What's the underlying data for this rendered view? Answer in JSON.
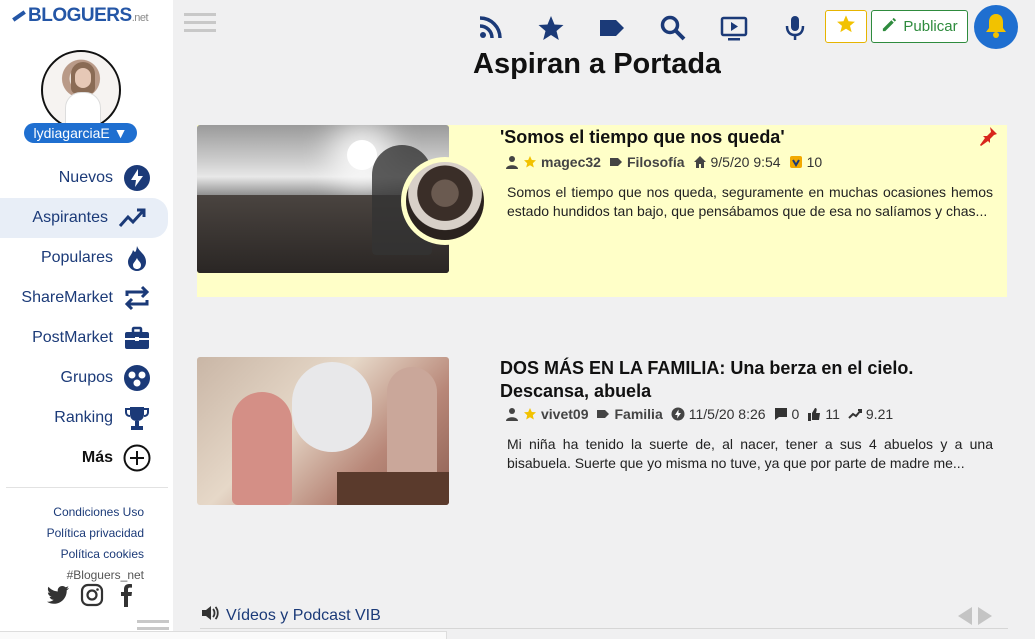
{
  "brand": {
    "name": "BLOGUERS",
    "suffix": ".net"
  },
  "user": {
    "name": "lydiagarciaE ▼"
  },
  "nav": [
    {
      "label": "Nuevos",
      "icon": "bolt-icon"
    },
    {
      "label": "Aspirantes",
      "icon": "trending-up-icon"
    },
    {
      "label": "Populares",
      "icon": "flame-icon"
    },
    {
      "label": "ShareMarket",
      "icon": "repeat-icon"
    },
    {
      "label": "PostMarket",
      "icon": "briefcase-icon"
    },
    {
      "label": "Grupos",
      "icon": "group-icon"
    },
    {
      "label": "Ranking",
      "icon": "trophy-icon"
    },
    {
      "label": "Más",
      "icon": "plus-circle-icon"
    }
  ],
  "footer": {
    "links": [
      "Condiciones Uso",
      "Política privacidad",
      "Política cookies"
    ],
    "hashtag": "#Bloguers_net"
  },
  "toolbar": {
    "publish_label": "Publicar",
    "icons": [
      "rss-icon",
      "star-icon",
      "tag-icon",
      "search-icon",
      "video-icon",
      "mic-icon"
    ]
  },
  "colors": {
    "primary": "#1b3a78",
    "accent_blue": "#1f6fd0",
    "highlight_bg": "#ffffc8",
    "publish_green": "#2e8b3d",
    "star_yellow": "#f2c200"
  },
  "page": {
    "title": "Aspiran a Portada"
  },
  "posts": [
    {
      "title": "'Somos el tiempo que nos queda'",
      "author": "magec32",
      "category": "Filosofía",
      "date": "9/5/20 9:54",
      "badge_count": "10",
      "excerpt": "Somos el tiempo que nos queda, seguramente en muchas ocasiones hemos estado hundidos tan bajo, que pensábamos que de esa no salíamos y chas..."
    },
    {
      "title": "DOS MÁS EN LA FAMILIA: Una berza en el cielo. Descansa, abuela",
      "author": "vivet09",
      "category": "Familia",
      "date": "11/5/20 8:26",
      "comments": "0",
      "likes": "11",
      "score": "9.21",
      "excerpt": "Mi niña ha tenido la suerte de, al nacer, tener a sus 4 abuelos y a una bisabuela. Suerte que yo misma no tuve, ya que por parte de madre me..."
    }
  ],
  "bottom": {
    "label": "Vídeos y Podcast VIB"
  }
}
